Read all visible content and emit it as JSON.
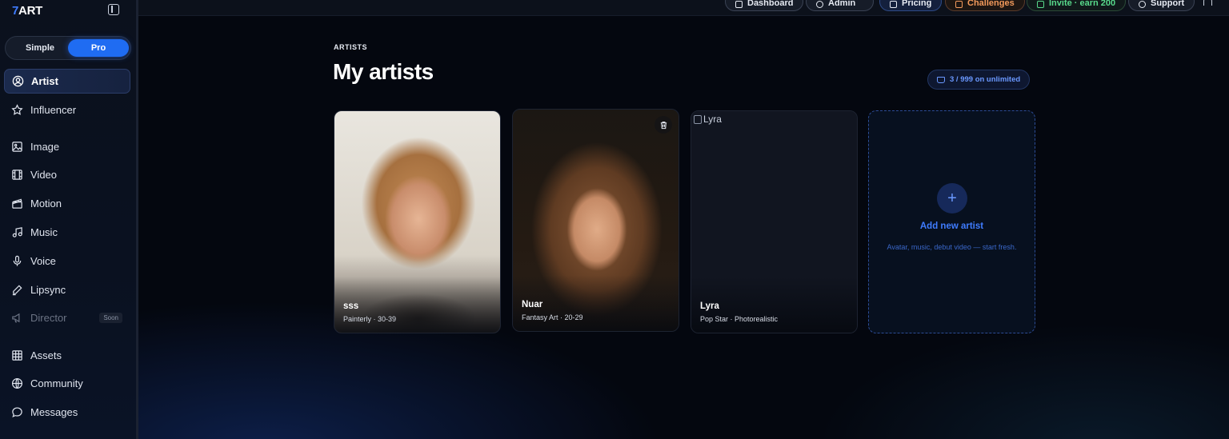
{
  "app": {
    "brand_prefix": "7",
    "brand_suffix": "ART"
  },
  "mode": {
    "simple": "Simple",
    "pro": "Pro",
    "selected": "Pro"
  },
  "sidebar": {
    "items": [
      {
        "label": "Artist",
        "icon": "user-circle-icon",
        "active": true
      },
      {
        "label": "Influencer",
        "icon": "star-icon"
      },
      {
        "label": "Image",
        "icon": "image-icon"
      },
      {
        "label": "Video",
        "icon": "film-icon"
      },
      {
        "label": "Motion",
        "icon": "clapper-icon"
      },
      {
        "label": "Music",
        "icon": "music-note-icon"
      },
      {
        "label": "Voice",
        "icon": "microphone-icon"
      },
      {
        "label": "Lipsync",
        "icon": "pen-icon"
      },
      {
        "label": "Director",
        "icon": "megaphone-icon",
        "disabled": true,
        "badge": "Soon"
      },
      {
        "label": "Assets",
        "icon": "grid-icon"
      },
      {
        "label": "Community",
        "icon": "globe-icon"
      },
      {
        "label": "Messages",
        "icon": "chat-bubble-icon"
      }
    ]
  },
  "topbar": {
    "dashboard": "Dashboard",
    "admin": "Admin",
    "pricing": "Pricing",
    "challenges": "Challenges",
    "invite": "Invite · earn 200",
    "support": "Support"
  },
  "page": {
    "eyebrow": "ARTISTS",
    "title": "My artists",
    "quota": "3 / 999 on unlimited"
  },
  "artists": [
    {
      "name": "sss",
      "meta": "Painterly · 30-39"
    },
    {
      "name": "Nuar",
      "meta": "Fantasy Art · 20-29"
    },
    {
      "name": "Lyra",
      "meta": "Pop Star · Photorealistic",
      "alt": "Lyra"
    }
  ],
  "add_card": {
    "title": "Add new artist",
    "subtitle": "Avatar, music, debut video — start fresh."
  },
  "colors": {
    "accent": "#1f6cf2",
    "challenges": "#f39a5b",
    "invite": "#58d98b"
  }
}
